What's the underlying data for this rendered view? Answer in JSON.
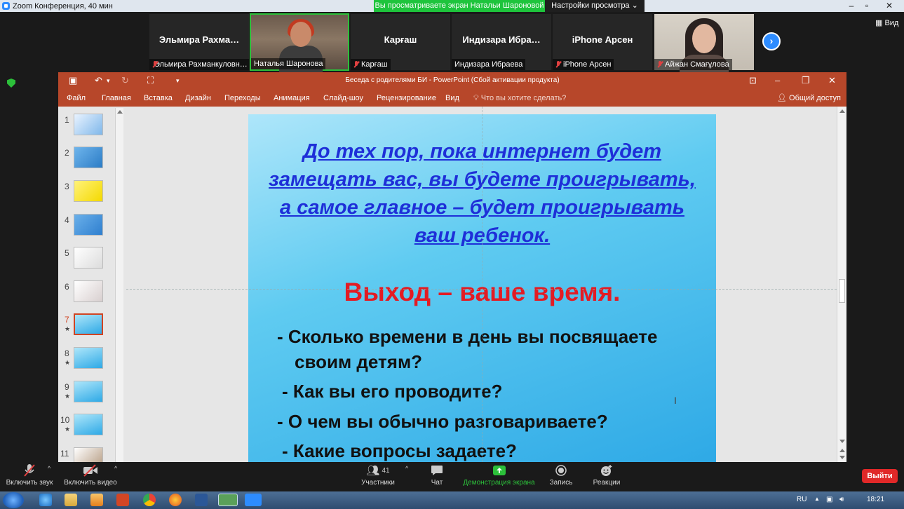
{
  "zoom": {
    "window_title": "Zoom Конференция, 40 мин",
    "share_banner": "Вы просматриваете экран Натальи Шароновой",
    "view_options": "Настройки просмотра ⌄",
    "view_button": "Вид",
    "participants": [
      {
        "display": "Эльмира  Рахма…",
        "label": "Эльмира Рахманкуловн…",
        "muted": true
      },
      {
        "display": "",
        "label": "Наталья Шаронова",
        "muted": false,
        "video": true,
        "active": true
      },
      {
        "display": "Карғаш",
        "label": "Карғаш",
        "muted": true
      },
      {
        "display": "Индизара  Ибра…",
        "label": "Индизара Ибраева",
        "muted": false
      },
      {
        "display": "iPhone Арсен",
        "label": "iPhone Арсен",
        "muted": true
      },
      {
        "display": "",
        "label": "Айжан Смағұлова",
        "muted": true,
        "video": true
      }
    ],
    "toolbar": {
      "audio": "Включить звук",
      "video": "Включить видео",
      "participants": "Участники",
      "participants_count": "41",
      "chat": "Чат",
      "share": "Демонстрация экрана",
      "record": "Запись",
      "reactions": "Реакции",
      "leave": "Выйти"
    }
  },
  "ppt": {
    "title": "Беседа с родителями БИ - PowerPoint (Сбой активации продукта)",
    "tabs": [
      "Файл",
      "Главная",
      "Вставка",
      "Дизайн",
      "Переходы",
      "Анимация",
      "Слайд-шоу",
      "Рецензирование",
      "Вид"
    ],
    "tell_me": "Что вы хотите сделать?",
    "share": "Общий доступ",
    "thumbnails": [
      {
        "num": "1",
        "star": ""
      },
      {
        "num": "2",
        "star": ""
      },
      {
        "num": "3",
        "star": ""
      },
      {
        "num": "4",
        "star": ""
      },
      {
        "num": "5",
        "star": ""
      },
      {
        "num": "6",
        "star": ""
      },
      {
        "num": "7",
        "star": "★",
        "selected": true
      },
      {
        "num": "8",
        "star": "★"
      },
      {
        "num": "9",
        "star": "★"
      },
      {
        "num": "10",
        "star": "★"
      },
      {
        "num": "11",
        "star": ""
      }
    ],
    "slide": {
      "quote": "До тех пор, пока интернет будет замещать вас, вы будете проигрывать, а самое главное – будет проигрывать ваш ребенок.",
      "heading": "Выход – ваше время.",
      "bullets": [
        "- Сколько времени в день вы посвящаете",
        "своим детям?",
        "- Как вы его проводите?",
        "- О чем вы обычно разговариваете?",
        "- Какие вопросы задаете?"
      ]
    }
  },
  "taskbar": {
    "lang": "RU",
    "time": "18:21"
  },
  "colors": {
    "ppt_accent": "#b7472a",
    "zoom_green": "#1ec43c",
    "leave_red": "#e02828",
    "slide_quote": "#1e2fd8",
    "slide_heading": "#e31b23"
  }
}
